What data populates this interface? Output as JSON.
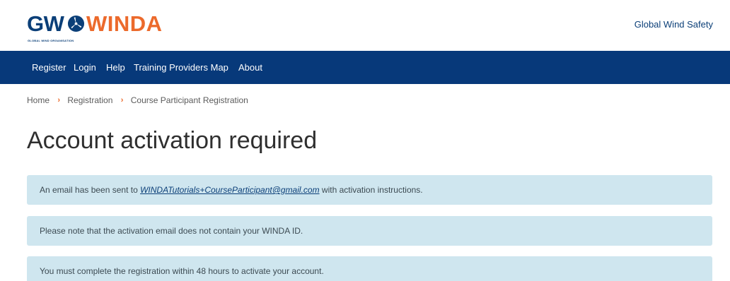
{
  "header": {
    "logo": {
      "gw": "GW",
      "winda": "WINDA",
      "subtitle": "GLOBAL WIND ORGANISATION"
    },
    "right_link": "Global Wind Safety"
  },
  "nav": {
    "items": [
      {
        "label": "Register"
      },
      {
        "label": "Login"
      },
      {
        "label": "Help"
      },
      {
        "label": "Training Providers Map"
      },
      {
        "label": "About"
      }
    ]
  },
  "breadcrumb": {
    "items": [
      {
        "label": "Home"
      },
      {
        "label": "Registration"
      },
      {
        "label": "Course Participant Registration"
      }
    ],
    "separator": "›"
  },
  "page": {
    "title": "Account activation required"
  },
  "alerts": {
    "email_prefix": "An email has been sent to ",
    "email": "WINDATutorials+CourseParticipant@gmail.com",
    "email_suffix": " with activation instructions.",
    "note": "Please note that the activation email does not contain your WINDA ID.",
    "deadline": "You must complete the registration within 48 hours to activate your account."
  },
  "colors": {
    "brand_blue": "#07397a",
    "brand_orange": "#ec6a2c",
    "alert_background": "#cfe6ef"
  }
}
